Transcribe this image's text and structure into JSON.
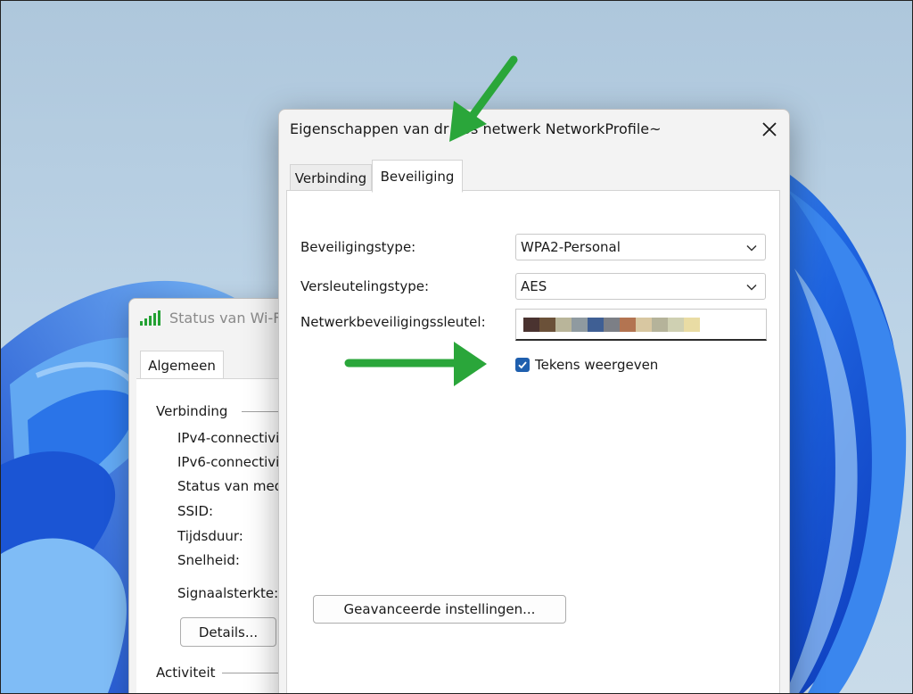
{
  "colors": {
    "accent": "#1f5fae",
    "annotation_arrow": "#2aa63a",
    "signal": "#23a133"
  },
  "back_window": {
    "title": "Status van Wi-F",
    "tab": "Algemeen",
    "group_connection": "Verbinding",
    "rows": [
      "IPv4-connectivi",
      "IPv6-connectivi",
      "Status van med",
      "SSID:",
      "Tijdsduur:",
      "Snelheid:"
    ],
    "signal_label": "Signaalsterkte:",
    "details_button": "Details...",
    "group_activity": "Activiteit"
  },
  "dialog": {
    "title": "Eigenschappen van dr     oos netwerk NetworkProfile~",
    "close_icon": "close-icon",
    "tabs": [
      {
        "label": "Verbinding",
        "active": false
      },
      {
        "label": "Beveiliging",
        "active": true
      }
    ],
    "security_type_label": "Beveiligingstype:",
    "security_type_value": "WPA2-Personal",
    "encryption_type_label": "Versleutelingstype:",
    "encryption_type_value": "AES",
    "network_key_label": "Netwerkbeveiligingssleutel:",
    "network_key_pixel_colors": [
      "#4a3330",
      "#6b5139",
      "#b9b59a",
      "#8f9aa0",
      "#3f5f94",
      "#7c7f86",
      "#b37451",
      "#d8c7a1",
      "#b5b39a",
      "#cfd0b2",
      "#e9dca4"
    ],
    "show_characters_label": "Tekens weergeven",
    "show_characters_checked": true,
    "advanced_button": "Geavanceerde instellingen..."
  }
}
